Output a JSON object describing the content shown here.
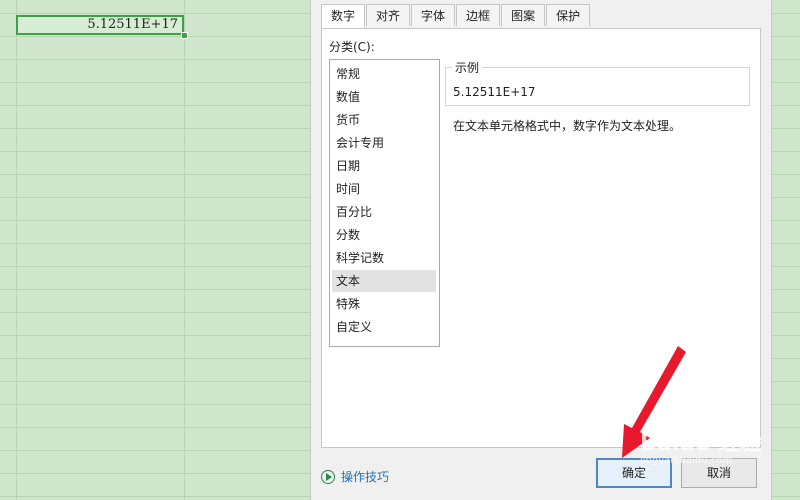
{
  "sheet": {
    "cell_value": "5.12511E+17"
  },
  "dialog": {
    "tabs": [
      {
        "label": "数字",
        "active": true
      },
      {
        "label": "对齐"
      },
      {
        "label": "字体"
      },
      {
        "label": "边框"
      },
      {
        "label": "图案"
      },
      {
        "label": "保护"
      }
    ],
    "category_label": "分类(C):",
    "categories": [
      "常规",
      "数值",
      "货币",
      "会计专用",
      "日期",
      "时间",
      "百分比",
      "分数",
      "科学记数",
      "文本",
      "特殊",
      "自定义"
    ],
    "selected_category": "文本",
    "sample_legend": "示例",
    "sample_value": "5.12511E+17",
    "description": "在文本单元格格式中，数字作为文本处理。",
    "tips_label": "操作技巧",
    "ok_label": "确定",
    "cancel_label": "取消"
  },
  "watermark": {
    "brand": "Baidu 经验",
    "url": "jingyan.baidu.com"
  },
  "colors": {
    "sheet_bg": "#cfe6cc",
    "cell_border": "#3f9f4a",
    "arrow": "#e8192c",
    "ok_border": "#4e88c7"
  }
}
